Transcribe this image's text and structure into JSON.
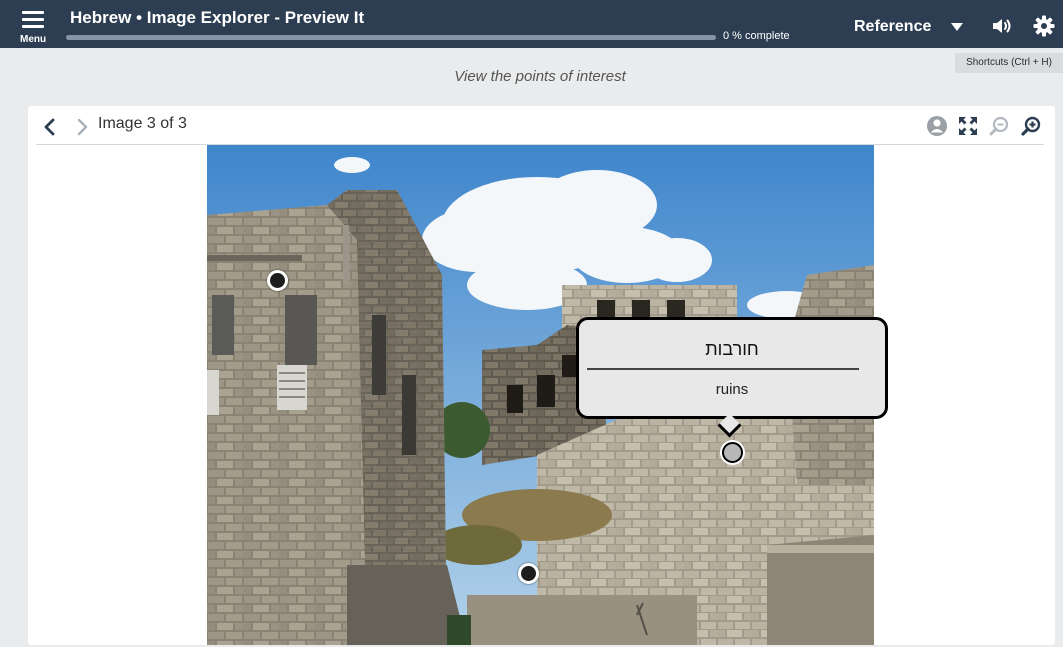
{
  "header": {
    "menu_label": "Menu",
    "title": "Hebrew • Image Explorer - Preview It",
    "progress_percent": 0,
    "progress_text": "0 % complete",
    "reference_label": "Reference",
    "icons": [
      "menu-icon",
      "caret-down-icon",
      "speaker-icon",
      "gear-icon"
    ]
  },
  "shortcuts_hint": "Shortcuts (Ctrl + H)",
  "instruction": "View the points of interest",
  "viewer": {
    "counter": "Image 3 of 3",
    "tools": [
      "person-icon",
      "fullscreen-icon",
      "zoom-out-icon",
      "zoom-in-icon"
    ]
  },
  "popover": {
    "hebrew": "חורבות",
    "english": "ruins"
  },
  "hotspots": [
    {
      "id": "upper-left",
      "active": false
    },
    {
      "id": "ruins",
      "active": true
    },
    {
      "id": "bottom",
      "active": false
    }
  ],
  "colors": {
    "topbar": "#2e3e52",
    "page_bg": "#e9ebec",
    "popover_bg": "#e8e8e8"
  }
}
